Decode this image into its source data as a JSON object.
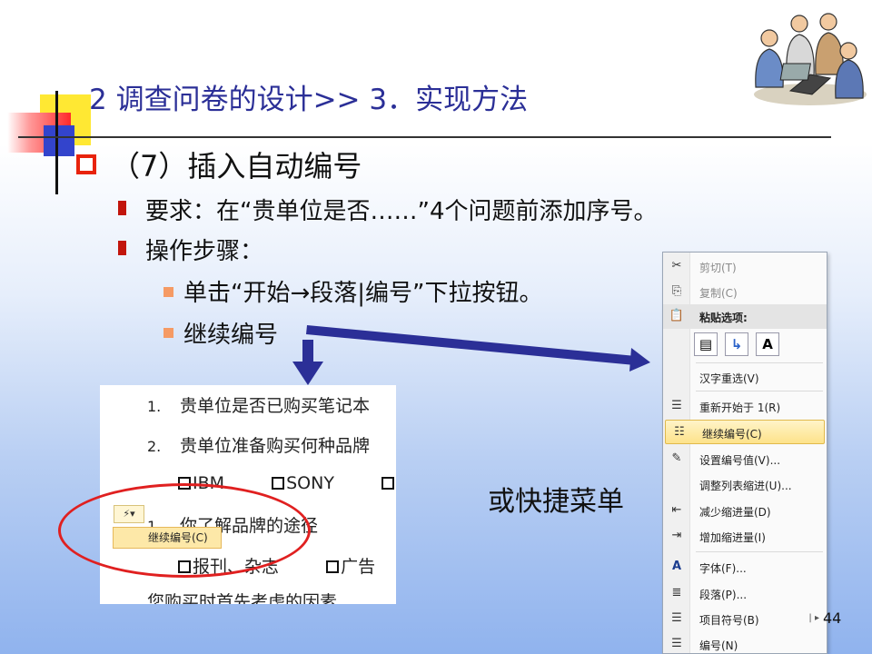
{
  "title": "2 调查问卷的设计>> 3．实现方法",
  "heading": "（7）插入自动编号",
  "bullets": {
    "requirement": "要求：在“贵单位是否……”4个问题前添加序号。",
    "steps": "操作步骤：",
    "step1": "单击“开始→段落|编号”下拉按钮。",
    "step2": "继续编号"
  },
  "or_shortcut": "或快捷菜单",
  "page_number": "44",
  "doc": {
    "row1_num": "1.",
    "row1_text": "贵单位是否已购买笔记本",
    "row2_num": "2.",
    "row2_text": "贵单位准备购买何种品牌",
    "opt1": "IBM",
    "opt2": "SONY",
    "row3_num": "1.",
    "row3_text": "你了解品牌的途径",
    "opt3": "报刊、杂志",
    "opt4": "广告",
    "row4_text": "您购买时首先考虑的因素",
    "autocorrect_popup": "继续编号(C)"
  },
  "context_menu": {
    "items": [
      {
        "label": "剪切(T)",
        "icon": "scissors-icon",
        "glyph": "✂"
      },
      {
        "label": "复制(C)",
        "icon": "copy-icon",
        "glyph": "⎘"
      },
      {
        "label": "粘贴选项:",
        "icon": "paste-icon",
        "glyph": "📋"
      },
      {
        "label": "汉字重选(V)",
        "icon": "",
        "glyph": ""
      },
      {
        "label": "重新开始于 1(R)",
        "icon": "restart-numbering-icon",
        "glyph": "☰"
      },
      {
        "label": "继续编号(C)",
        "icon": "continue-numbering-icon",
        "glyph": "☷"
      },
      {
        "label": "设置编号值(V)...",
        "icon": "set-value-icon",
        "glyph": "✎"
      },
      {
        "label": "调整列表缩进(U)...",
        "icon": "",
        "glyph": ""
      },
      {
        "label": "减少缩进量(D)",
        "icon": "decrease-indent-icon",
        "glyph": "⇤"
      },
      {
        "label": "增加缩进量(I)",
        "icon": "increase-indent-icon",
        "glyph": "⇥"
      },
      {
        "label": "字体(F)...",
        "icon": "font-icon",
        "glyph": "A"
      },
      {
        "label": "段落(P)...",
        "icon": "paragraph-icon",
        "glyph": "≣"
      },
      {
        "label": "项目符号(B)",
        "icon": "bullets-icon",
        "glyph": "☰"
      },
      {
        "label": "编号(N)",
        "icon": "numbering-icon",
        "glyph": "☰"
      }
    ],
    "paste_buttons": [
      "paste-keep-format",
      "paste-merge",
      "A"
    ]
  },
  "colors": {
    "title": "#2b2f97",
    "accent_red": "#e8230c",
    "highlight": "#fde28a"
  }
}
